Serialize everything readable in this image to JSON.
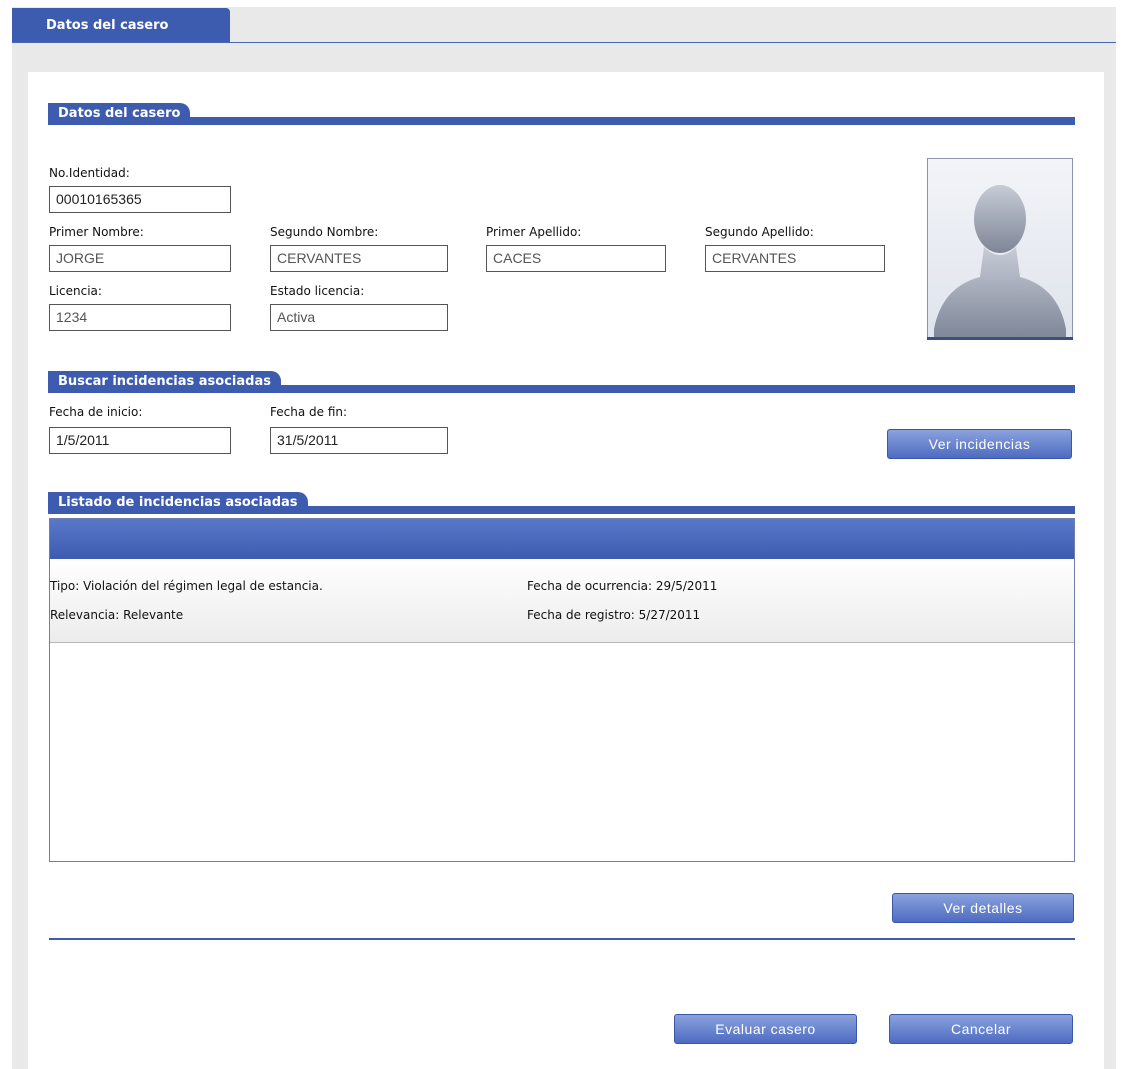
{
  "tab": {
    "title": "Datos del casero"
  },
  "section_owner": {
    "title": "Datos del casero",
    "identity": {
      "label": "No.Identidad:",
      "value": "00010165365"
    },
    "first_name": {
      "label": "Primer Nombre:",
      "value": "JORGE"
    },
    "second_name": {
      "label": "Segundo Nombre:",
      "value": "CERVANTES"
    },
    "first_surname": {
      "label": "Primer Apellido:",
      "value": "CACES"
    },
    "second_surname": {
      "label": "Segundo Apellido:",
      "value": "CERVANTES"
    },
    "license": {
      "label": "Licencia:",
      "value": "1234"
    },
    "license_state": {
      "label": "Estado licencia:",
      "value": "Activa"
    },
    "photo": {
      "icon": "avatar-placeholder-icon"
    }
  },
  "section_search": {
    "title": "Buscar incidencias asociadas",
    "start_date": {
      "label": "Fecha de inicio:",
      "value": "1/5/2011"
    },
    "end_date": {
      "label": "Fecha de fin:",
      "value": "31/5/2011"
    },
    "view_button": "Ver incidencias"
  },
  "section_list": {
    "title": "Listado de incidencias asociadas",
    "items": [
      {
        "tipo": "Tipo: Violación del régimen legal de estancia.",
        "relevancia": "Relevancia: Relevante",
        "fecha_ocurrencia": "Fecha de ocurrencia: 29/5/2011",
        "fecha_registro": "Fecha de registro: 5/27/2011"
      }
    ],
    "details_button": "Ver detalles"
  },
  "footer": {
    "evaluate_button": "Evaluar casero",
    "cancel_button": "Cancelar"
  },
  "colors": {
    "accent": "#3d5cb0",
    "button_top": "#8aa2dc",
    "button_bottom": "#4d6bc2"
  }
}
